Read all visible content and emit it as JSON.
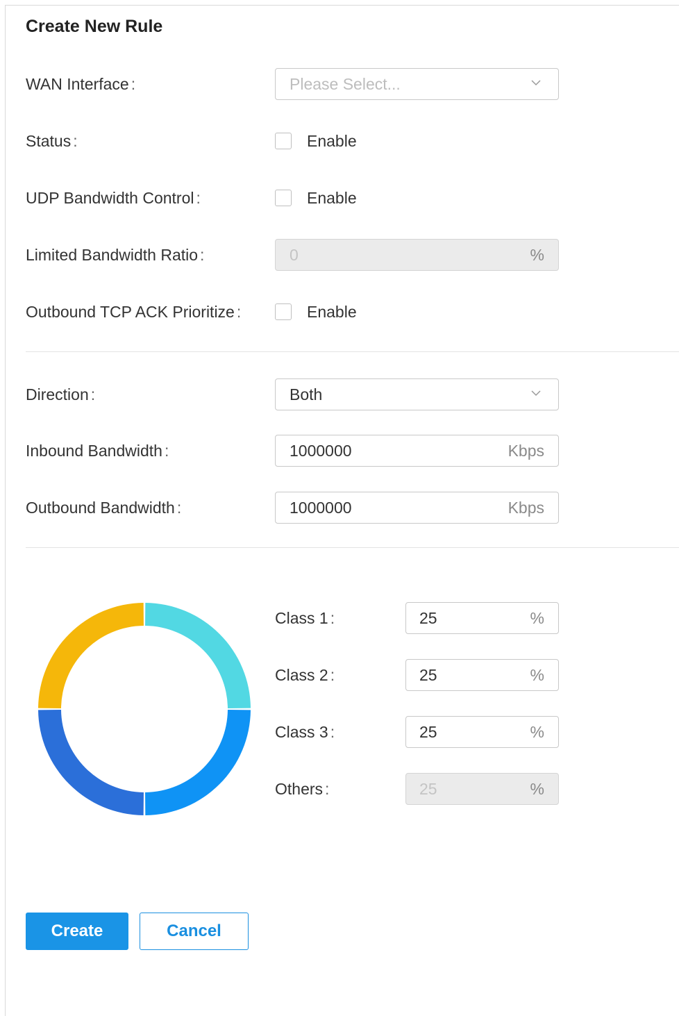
{
  "form": {
    "title": "Create New Rule",
    "wan_interface": {
      "label": "WAN Interface",
      "placeholder": "Please Select..."
    },
    "status": {
      "label": "Status",
      "checkbox_label": "Enable",
      "checked": false
    },
    "udp_bandwidth_control": {
      "label": "UDP Bandwidth Control",
      "checkbox_label": "Enable",
      "checked": false
    },
    "limited_bandwidth_ratio": {
      "label": "Limited Bandwidth Ratio",
      "value": "0",
      "unit": "%"
    },
    "outbound_tcp_ack": {
      "label": "Outbound TCP ACK Prioritize",
      "checkbox_label": "Enable",
      "checked": false
    },
    "direction": {
      "label": "Direction",
      "value": "Both"
    },
    "inbound_bandwidth": {
      "label": "Inbound Bandwidth",
      "value": "1000000",
      "unit": "Kbps"
    },
    "outbound_bandwidth": {
      "label": "Outbound Bandwidth",
      "value": "1000000",
      "unit": "Kbps"
    },
    "colon": ":"
  },
  "classes": [
    {
      "label": "Class 1",
      "value": "25",
      "unit": "%",
      "percent": 25,
      "color": "#52d8e3"
    },
    {
      "label": "Class 2",
      "value": "25",
      "unit": "%",
      "percent": 25,
      "color": "#0f93f5"
    },
    {
      "label": "Class 3",
      "value": "25",
      "unit": "%",
      "percent": 25,
      "color": "#2b6fd9"
    },
    {
      "label": "Others",
      "value": "25",
      "unit": "%",
      "percent": 25,
      "color": "#f5b70a"
    }
  ],
  "buttons": {
    "create": "Create",
    "cancel": "Cancel"
  },
  "colors": {
    "primary": "#1a94e6"
  }
}
